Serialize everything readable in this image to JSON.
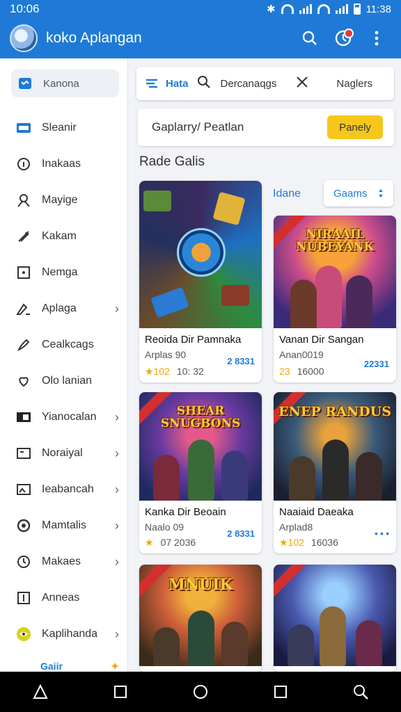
{
  "status": {
    "time": "10:06",
    "time_right": "11:38"
  },
  "app": {
    "title": "koko Aplangan"
  },
  "sidebar": {
    "top_item": "Kanona",
    "items": [
      {
        "label": "Sleanir",
        "icon": "screen-icon",
        "chevron": false
      },
      {
        "label": "Inakaas",
        "icon": "info-icon",
        "chevron": false
      },
      {
        "label": "Mayige",
        "icon": "person-icon",
        "chevron": false
      },
      {
        "label": "Kakam",
        "icon": "tag-icon",
        "chevron": false
      },
      {
        "label": "Nemga",
        "icon": "square-icon",
        "chevron": false
      },
      {
        "label": "Aplaga",
        "icon": "pencil-icon",
        "chevron": true
      },
      {
        "label": "Cealkcags",
        "icon": "brush-icon",
        "chevron": false
      },
      {
        "label": "Olo lanian",
        "icon": "heart-icon",
        "chevron": false
      },
      {
        "label": "Yianocalan",
        "icon": "folder-icon",
        "chevron": true
      },
      {
        "label": "Noraiyal",
        "icon": "card-icon",
        "chevron": true
      },
      {
        "label": "Ieabancah",
        "icon": "image-icon",
        "chevron": true
      },
      {
        "label": "Mamtalis",
        "icon": "chat-icon",
        "chevron": true
      },
      {
        "label": "Makaes",
        "icon": "clock-icon",
        "chevron": true
      },
      {
        "label": "Anneas",
        "icon": "plus-box-icon",
        "chevron": false
      },
      {
        "label": "Kaplihanda",
        "icon": "eye-icon",
        "chevron": true
      }
    ],
    "bottom_label": "Gaiir",
    "bottom_indicator": "✦"
  },
  "filterbar": {
    "active": "Hata",
    "middle": "Dercanaqgs",
    "right": "Naglers"
  },
  "search": {
    "text": "Gaplarry/ Peatlan",
    "button": "Panely"
  },
  "section_title": "Rade Galis",
  "sort": {
    "label": "Idane",
    "button": "Gaams"
  },
  "cards": [
    {
      "title": "Reoida Dir Pamnaka",
      "sub": "Arplas 90",
      "rating": "★102",
      "time": "10: 32",
      "price": "2 8331",
      "thumb_title": ""
    },
    {
      "title": "Vanan Dir Sangan",
      "sub": "Anan0019",
      "rating": "23",
      "time": "16000",
      "price": "22331",
      "thumb_title": "NIRAAIL NUBEYANK"
    },
    {
      "title": "Kanka Dir Beoain",
      "sub": "Naalo 09",
      "rating": "★",
      "time": "07 2036",
      "price": "2 8331",
      "thumb_title": "SHEAR SNUGBONS"
    },
    {
      "title": "Naaiaid Daeaka",
      "sub": "Arplad8",
      "rating": "★102",
      "time": "16036",
      "price": "• • •",
      "thumb_title": "ENEP RANDUS"
    },
    {
      "title": "",
      "sub": "",
      "rating": "",
      "time": "",
      "price": "",
      "thumb_title": "MNUIK"
    },
    {
      "title": "",
      "sub": "",
      "rating": "",
      "time": "",
      "price": "",
      "thumb_title": ""
    }
  ]
}
